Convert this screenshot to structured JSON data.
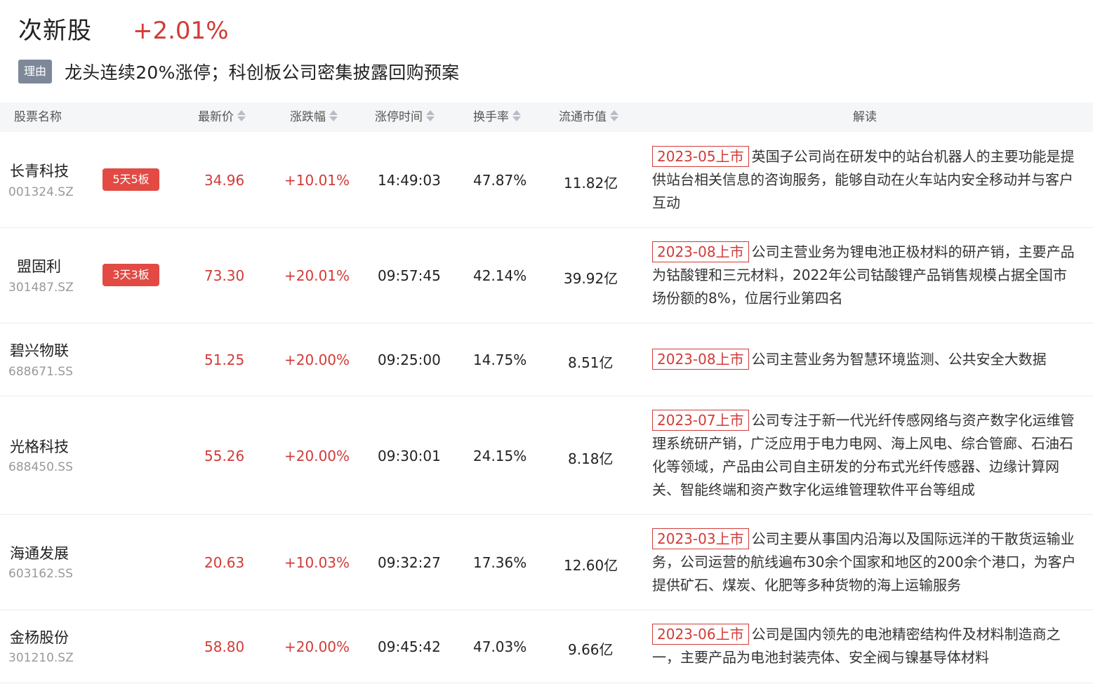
{
  "header": {
    "title": "次新股",
    "change": "+2.01%"
  },
  "reason": {
    "tag": "理由",
    "text": "龙头连续20%涨停；科创板公司密集披露回购预案"
  },
  "columns": {
    "name": "股票名称",
    "price": "最新价",
    "pct": "涨跌幅",
    "limit_time": "涨停时间",
    "turnover": "换手率",
    "float_cap": "流通市值",
    "desc": "解读"
  },
  "colors": {
    "up": "#d23b37",
    "board_badge": "#e24a43",
    "reason_tag": "#7d8899"
  },
  "rows": [
    {
      "name": "长青科技",
      "code": "001324.SZ",
      "board": "5天5板",
      "price": "34.96",
      "pct": "+10.01%",
      "time": "14:49:03",
      "turnover": "47.87%",
      "cap": "11.82亿",
      "date": "2023-05上市",
      "desc": "英国子公司尚在研发中的站台机器人的主要功能是提供站台相关信息的咨询服务，能够自动在火车站内安全移动并与客户互动"
    },
    {
      "name": "盟固利",
      "code": "301487.SZ",
      "board": "3天3板",
      "price": "73.30",
      "pct": "+20.01%",
      "time": "09:57:45",
      "turnover": "42.14%",
      "cap": "39.92亿",
      "date": "2023-08上市",
      "desc": "公司主营业务为锂电池正极材料的研产销，主要产品为钴酸锂和三元材料，2022年公司钴酸锂产品销售规模占据全国市场份额的8%，位居行业第四名"
    },
    {
      "name": "碧兴物联",
      "code": "688671.SS",
      "board": "",
      "price": "51.25",
      "pct": "+20.00%",
      "time": "09:25:00",
      "turnover": "14.75%",
      "cap": "8.51亿",
      "date": "2023-08上市",
      "desc": "公司主营业务为智慧环境监测、公共安全大数据"
    },
    {
      "name": "光格科技",
      "code": "688450.SS",
      "board": "",
      "price": "55.26",
      "pct": "+20.00%",
      "time": "09:30:01",
      "turnover": "24.15%",
      "cap": "8.18亿",
      "date": "2023-07上市",
      "desc": "公司专注于新一代光纤传感网络与资产数字化运维管理系统研产销，广泛应用于电力电网、海上风电、综合管廊、石油石化等领域，产品由公司自主研发的分布式光纤传感器、边缘计算网关、智能终端和资产数字化运维管理软件平台等组成"
    },
    {
      "name": "海通发展",
      "code": "603162.SS",
      "board": "",
      "price": "20.63",
      "pct": "+10.03%",
      "time": "09:32:27",
      "turnover": "17.36%",
      "cap": "12.60亿",
      "date": "2023-03上市",
      "desc": "公司主要从事国内沿海以及国际远洋的干散货运输业务，公司运营的航线遍布30余个国家和地区的200余个港口，为客户提供矿石、煤炭、化肥等多种货物的海上运输服务"
    },
    {
      "name": "金杨股份",
      "code": "301210.SZ",
      "board": "",
      "price": "58.80",
      "pct": "+20.00%",
      "time": "09:45:42",
      "turnover": "47.03%",
      "cap": "9.66亿",
      "date": "2023-06上市",
      "desc": "公司是国内领先的电池精密结构件及材料制造商之一，主要产品为电池封装壳体、安全阀与镍基导体材料"
    }
  ]
}
